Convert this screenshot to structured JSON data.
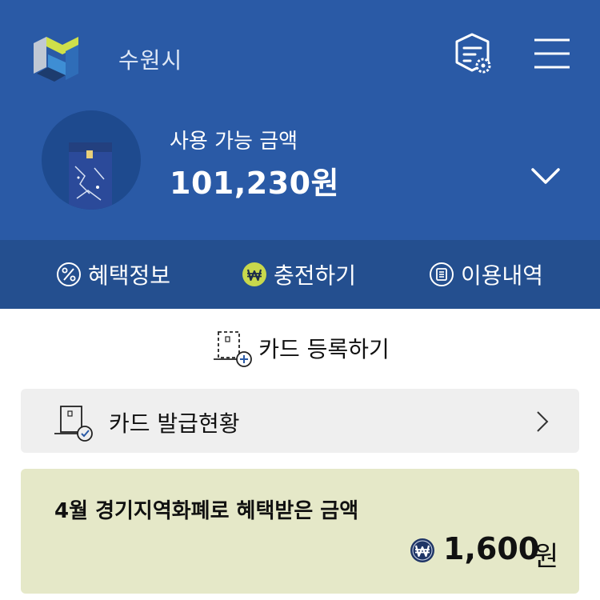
{
  "header": {
    "city": "수원시",
    "available_label": "사용 가능 금액",
    "available_amount": "101,230원"
  },
  "tabs": [
    {
      "label": "혜택정보",
      "icon": "percent-icon"
    },
    {
      "label": "충전하기",
      "icon": "won-icon"
    },
    {
      "label": "이용내역",
      "icon": "list-icon"
    }
  ],
  "actions": {
    "register_card": "카드 등록하기",
    "card_issue_status": "카드 발급현황"
  },
  "benefit": {
    "title": "4월 경기지역화폐로 혜택받은 금액",
    "amount": "1,600",
    "currency_unit": "원"
  },
  "colors": {
    "header_bg": "#2a5aa6",
    "tabbar_bg": "#244f8f",
    "won_badge": "#c8d84c",
    "benefit_bg": "#e5e8c8",
    "status_bg": "#efefef"
  }
}
